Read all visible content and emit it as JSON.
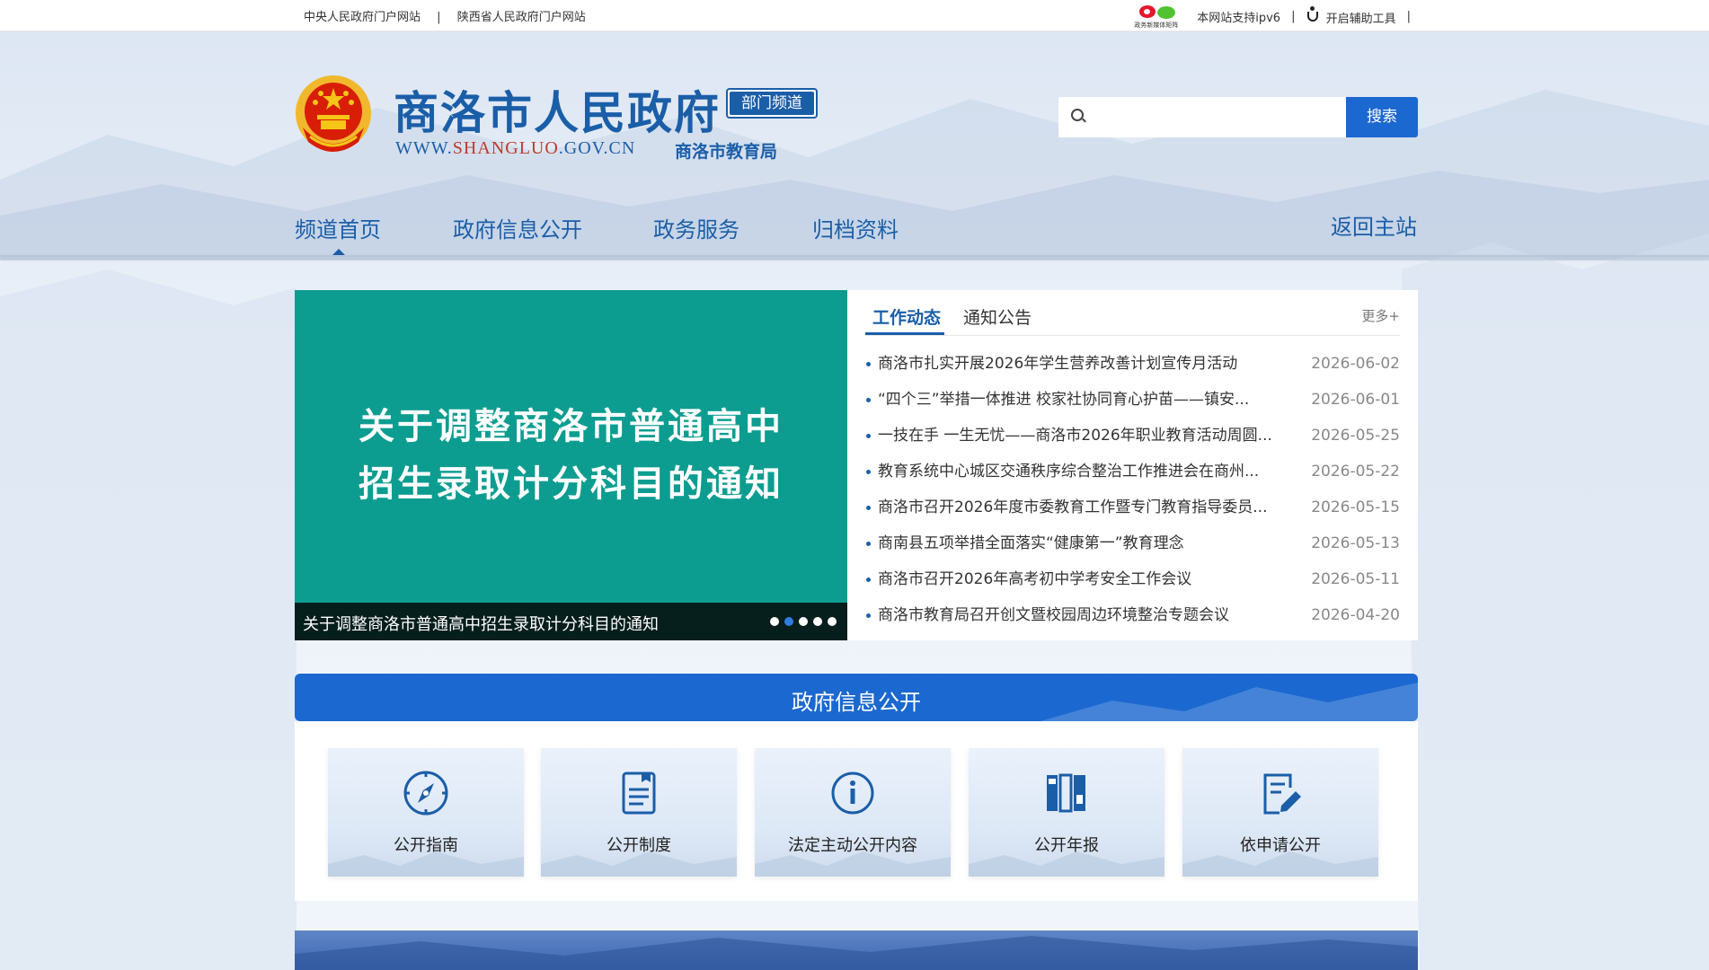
{
  "topbar": {
    "link_central": "中央人民政府门户网站",
    "separator": "|",
    "link_province": "陕西省人民政府门户网站",
    "weibo_caption": "政务新媒体矩阵",
    "ipv6": "本网站支持ipv6",
    "accessibility": "开启辅助工具"
  },
  "header": {
    "site_title": "商洛市人民政府",
    "dept_tag": "部门频道",
    "url_prefix": "WWW.",
    "url_highlight": "SHANGLUO",
    "url_suffix": ".GOV.CN",
    "dept_name": "商洛市教育局"
  },
  "search": {
    "placeholder": "",
    "button": "搜索"
  },
  "nav": {
    "items": [
      "频道首页",
      "政府信息公开",
      "政务服务",
      "归档资料"
    ],
    "active": "频道首页",
    "back": "返回主站"
  },
  "slider": {
    "headline_line1": "关于调整商洛市普通高中",
    "headline_line2": "招生录取计分科目的通知",
    "caption": "关于调整商洛市普通高中招生录取计分科目的通知",
    "dot_count": 5,
    "active_dot": 2,
    "bg_color": "#0d9d90"
  },
  "news": {
    "tabs": [
      "工作动态",
      "通知公告"
    ],
    "active_tab": "工作动态",
    "more": "更多+",
    "items": [
      {
        "title": "商洛市扎实开展2026年学生营养改善计划宣传月活动",
        "date": "2026-06-02"
      },
      {
        "title": "“四个三”举措一体推进 校家社协同育心护苗——镇安...",
        "date": "2026-06-01"
      },
      {
        "title": "一技在手 一生无忧——商洛市2026年职业教育活动周圆...",
        "date": "2026-05-25"
      },
      {
        "title": "教育系统中心城区交通秩序综合整治工作推进会在商州...",
        "date": "2026-05-22"
      },
      {
        "title": "商洛市召开2026年度市委教育工作暨专门教育指导委员...",
        "date": "2026-05-15"
      },
      {
        "title": "商南县五项举措全面落实“健康第一”教育理念",
        "date": "2026-05-13"
      },
      {
        "title": "商洛市召开2026年高考初中学考安全工作会议",
        "date": "2026-05-11"
      },
      {
        "title": "商洛市教育局召开创文暨校园周边环境整治专题会议",
        "date": "2026-04-20"
      }
    ]
  },
  "info_section": {
    "title": "政府信息公开",
    "cards": [
      {
        "label": "公开指南",
        "icon": "compass-icon"
      },
      {
        "label": "公开制度",
        "icon": "document-icon"
      },
      {
        "label": "法定主动公开内容",
        "icon": "info-icon"
      },
      {
        "label": "公开年报",
        "icon": "books-icon"
      },
      {
        "label": "依申请公开",
        "icon": "edit-document-icon"
      }
    ]
  },
  "colors": {
    "brand": "#1b5ea8",
    "accent": "#1b68d0",
    "teal": "#0d9d90"
  }
}
